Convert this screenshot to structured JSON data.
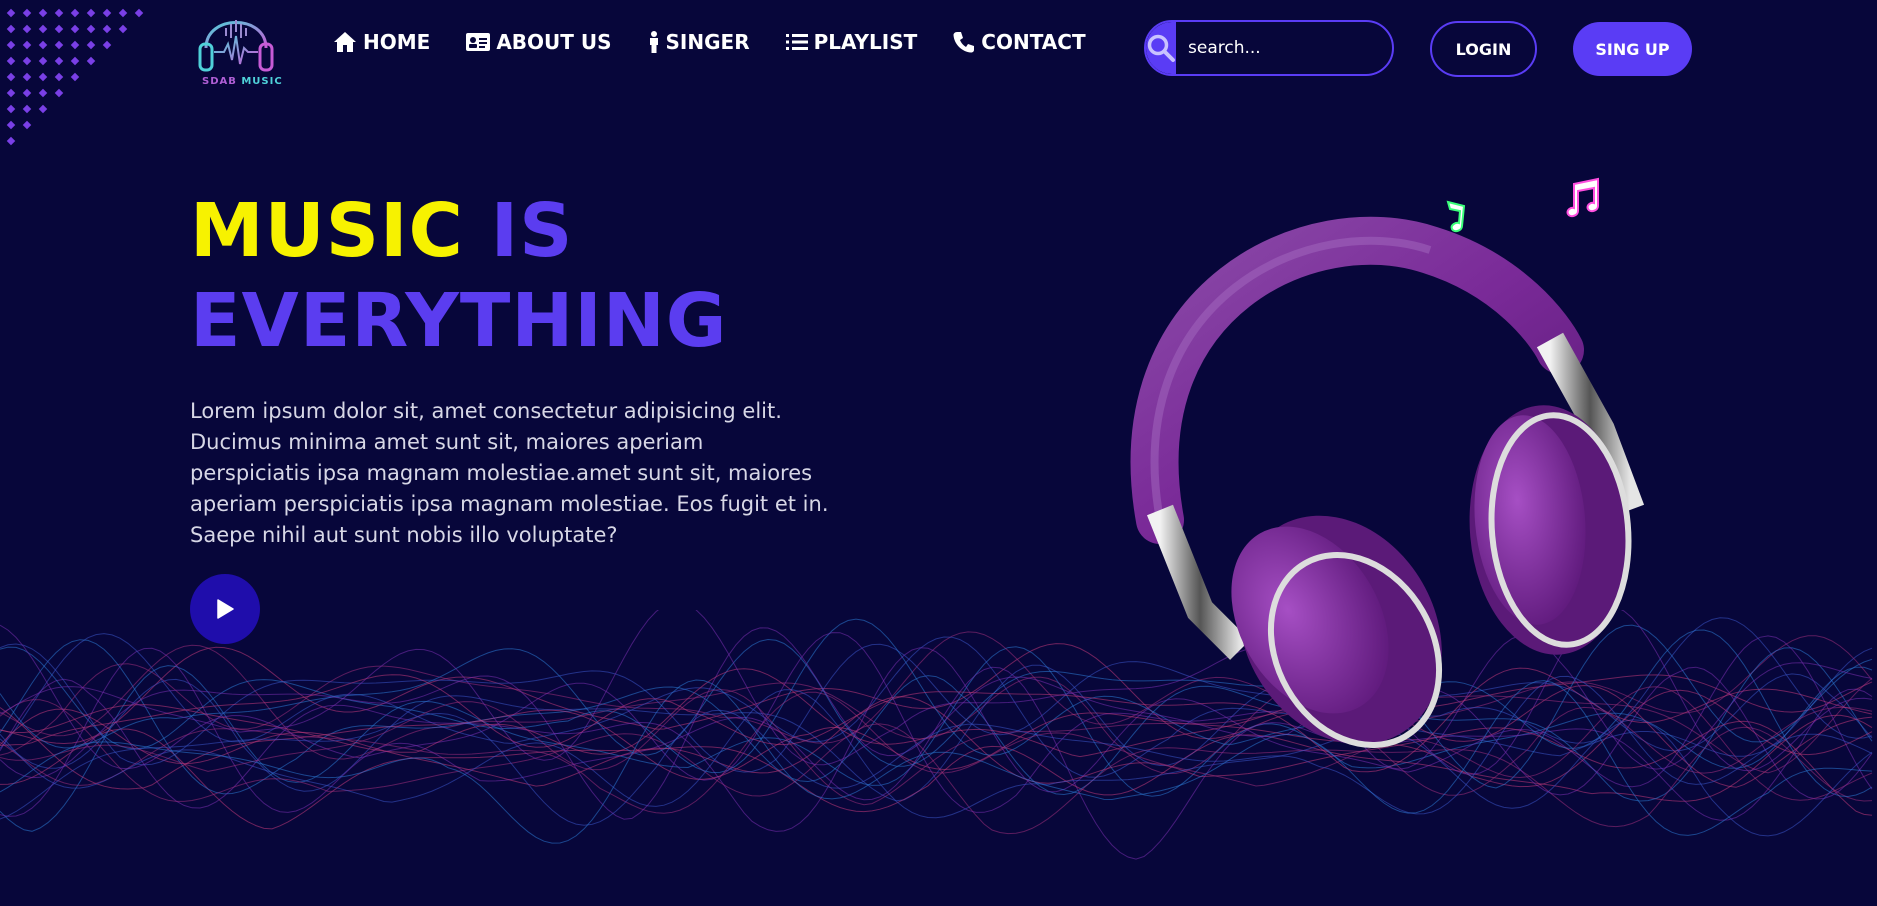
{
  "brand": {
    "logo_text_a": "SDAB",
    "logo_text_b": "MUSIC"
  },
  "nav": {
    "items": [
      {
        "label": "HOME",
        "icon": "home-icon"
      },
      {
        "label": "ABOUT US",
        "icon": "id-card-icon"
      },
      {
        "label": "SINGER",
        "icon": "person-icon"
      },
      {
        "label": "PLAYLIST",
        "icon": "list-icon"
      },
      {
        "label": "CONTACT",
        "icon": "phone-icon"
      }
    ]
  },
  "search": {
    "placeholder": "search..."
  },
  "auth": {
    "login_label": "LOGIN",
    "signup_label": "SING UP"
  },
  "hero": {
    "title_word1": "MUSIC",
    "title_word2": "IS",
    "title_line2": "EVERYTHING",
    "text": "Lorem ipsum dolor sit, amet consectetur adipisicing elit. Ducimus minima amet sunt sit, maiores aperiam perspiciatis ipsa magnam molestiae.amet sunt sit, maiores aperiam perspiciatis ipsa magnam molestiae. Eos fugit et in. Saepe nihil aut sunt nobis illo voluptate?"
  },
  "colors": {
    "background": "#07063a",
    "accent": "#5a3cf5",
    "title_yellow": "#f7f200",
    "play_button": "#1f0dab",
    "headphone_purple": "#8a2ba8"
  }
}
